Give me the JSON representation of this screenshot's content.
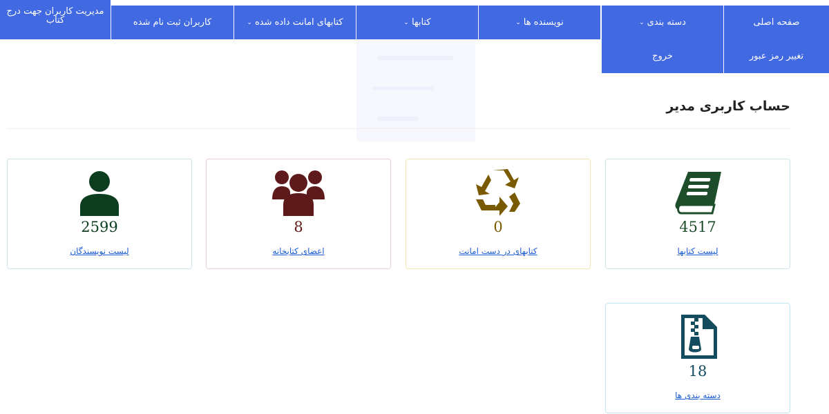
{
  "nav": {
    "home": "صفحه اصلی",
    "categories": "دسته بندی",
    "authors": "نویسنده ها",
    "books": "کتابها",
    "loaned_books": "کتابهای امانت داده شده",
    "registered_users": "کاربران ثبت نام شده",
    "manage_users": "مدیریت کاربران جهت درج کتاب",
    "change_password": "تغییر رمز عبور",
    "logout": "خروج",
    "chevron": "⌄"
  },
  "page": {
    "title": "حساب کاربری مدیر"
  },
  "cards": {
    "books": {
      "icon": "book-icon",
      "count": "4517",
      "link": "لیست کتابها",
      "color": "#1e4d2b",
      "border": "#cfe3ea"
    },
    "loaned": {
      "icon": "recycle-icon",
      "count": "0",
      "link": "کتابهای در دست امانت",
      "color": "#7a5a00",
      "border": "#f2e8b0"
    },
    "members": {
      "icon": "users-icon",
      "count": "8",
      "link": "اعضای کتابخانه",
      "color": "#5e1a1a",
      "border": "#ebd0d4"
    },
    "authors": {
      "icon": "user-icon",
      "count": "2599",
      "link": "لیست نویسندگان",
      "color": "#0d3d1f",
      "border": "#cfe3ea"
    },
    "categories": {
      "icon": "file-zip-icon",
      "count": "18",
      "link": "دسته بندی ها",
      "color": "#134b5f",
      "border": "#bfe8ee"
    }
  },
  "colors": {
    "nav_bg": "#4169e1",
    "link": "#1a5ad0"
  }
}
